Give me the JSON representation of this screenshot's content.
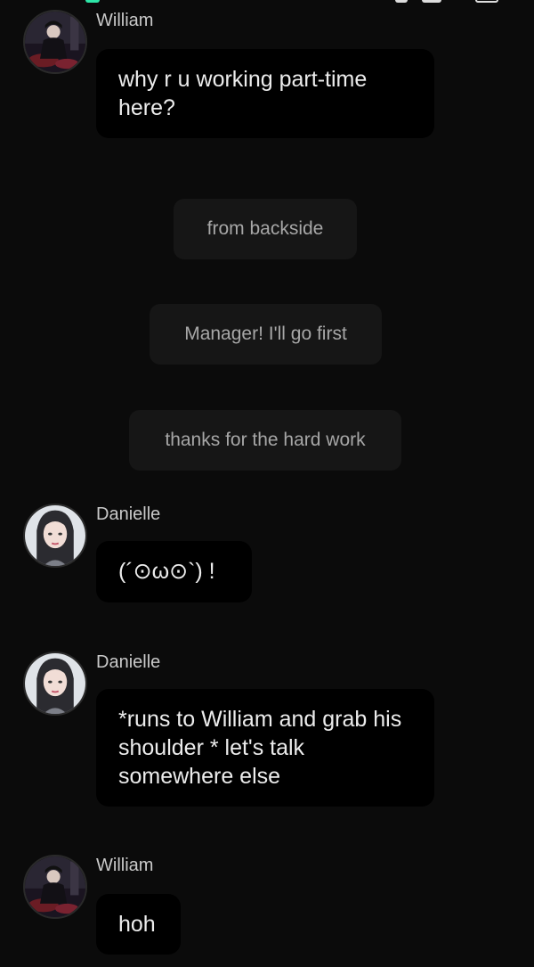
{
  "messages": [
    {
      "sender": "William",
      "avatar": "william-avatar",
      "text": "why r u working part-time here?"
    },
    {
      "sender": "Danielle",
      "avatar": "danielle-avatar",
      "text": "(´⊙ω⊙`) !"
    },
    {
      "sender": "Danielle",
      "avatar": "danielle-avatar",
      "text": "*runs to William and grab his shoulder * let's talk somewhere else"
    },
    {
      "sender": "William",
      "avatar": "william-avatar",
      "text": "hoh"
    }
  ],
  "narrations": [
    "from backside",
    "Manager! I'll go first",
    "thanks for the hard work"
  ],
  "colors": {
    "background": "#0b0b0b",
    "bubble": "#000000",
    "narration_bg": "#161616",
    "narration_text": "#a7a7a7",
    "accent": "#2ee6a8"
  }
}
